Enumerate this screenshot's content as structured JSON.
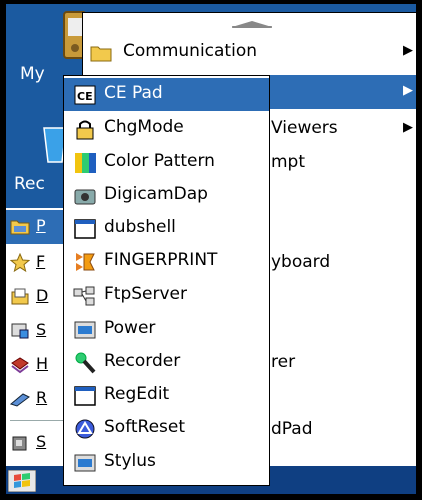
{
  "desktop": {
    "icon1_label": "My",
    "icon2_label": "Rec"
  },
  "programs_menu": {
    "items": [
      {
        "label": "Communication",
        "icon": "folder-icon",
        "has_submenu": true
      },
      {
        "label": "",
        "icon": "",
        "has_submenu": true
      },
      {
        "label": "Viewers",
        "icon": "",
        "has_submenu": true
      },
      {
        "label": "mpt",
        "icon": "",
        "has_submenu": false
      },
      {
        "label": "yboard",
        "icon": "",
        "has_submenu": false
      },
      {
        "label": "rer",
        "icon": "",
        "has_submenu": false
      },
      {
        "label": "dPad",
        "icon": "",
        "has_submenu": false
      }
    ]
  },
  "start_menu": {
    "items": [
      {
        "fragment": "P",
        "icon": "programs-folder-icon"
      },
      {
        "fragment": "F",
        "icon": "favorites-star-icon"
      },
      {
        "fragment": "D",
        "icon": "documents-icon"
      },
      {
        "fragment": "S",
        "icon": "settings-icon"
      },
      {
        "fragment": "H",
        "icon": "help-book-icon"
      },
      {
        "fragment": "R",
        "icon": "run-icon"
      },
      {
        "fragment": "S",
        "icon": "suspend-icon"
      }
    ]
  },
  "accessories_menu": {
    "items": [
      {
        "label": "CE Pad",
        "icon": "ce-pad-icon"
      },
      {
        "label": "ChgMode",
        "icon": "lock-icon"
      },
      {
        "label": "Color Pattern",
        "icon": "color-pattern-icon"
      },
      {
        "label": "DigicamDap",
        "icon": "camera-icon"
      },
      {
        "label": "dubshell",
        "icon": "window-icon"
      },
      {
        "label": "FINGERPRINT",
        "icon": "fingerprint-icon"
      },
      {
        "label": "FtpServer",
        "icon": "network-icon"
      },
      {
        "label": "Power",
        "icon": "power-icon"
      },
      {
        "label": "Recorder",
        "icon": "microphone-icon"
      },
      {
        "label": "RegEdit",
        "icon": "window-icon"
      },
      {
        "label": "SoftReset",
        "icon": "reset-icon"
      },
      {
        "label": "Stylus",
        "icon": "stylus-icon"
      }
    ]
  },
  "colors": {
    "desktop": "#1b5aa0",
    "highlight": "#2d6db5",
    "menu_bg": "#ffffff"
  }
}
